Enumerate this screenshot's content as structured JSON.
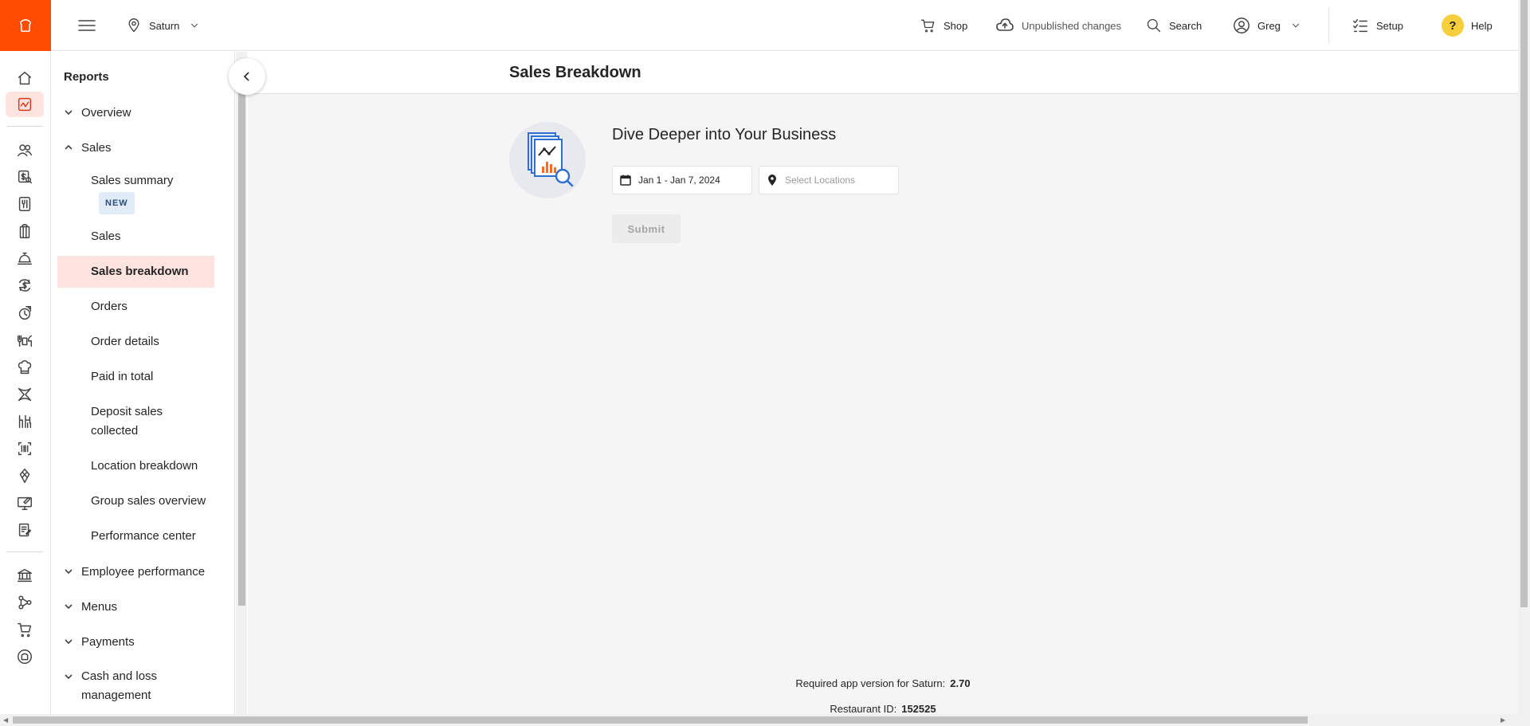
{
  "topbar": {
    "location": "Saturn",
    "shop": "Shop",
    "unpublished": "Unpublished changes",
    "search": "Search",
    "user": "Greg",
    "setup": "Setup",
    "help": "Help",
    "help_glyph": "?"
  },
  "rail": {
    "icons": [
      "home-icon",
      "reports-icon",
      "guests-icon",
      "payroll-icon",
      "menu-icon",
      "retail-icon",
      "service-icon",
      "money-icon",
      "marketing-icon",
      "dining-icon",
      "kitchen-icon",
      "integrations-icon",
      "floor-icon",
      "barcode-icon",
      "loyalty-icon",
      "kiosk-icon",
      "forms-icon",
      "bank-icon",
      "network-icon",
      "cart-icon",
      "brand-icon"
    ]
  },
  "sidebar": {
    "title": "Reports",
    "sections": {
      "overview": "Overview",
      "sales": "Sales",
      "employee_performance": "Employee performance",
      "menus": "Menus",
      "payments": "Payments",
      "cash_loss_1": "Cash and loss",
      "cash_loss_2": "management"
    },
    "items": {
      "sales_summary": "Sales summary",
      "new_badge": "NEW",
      "sales": "Sales",
      "sales_breakdown": "Sales breakdown",
      "orders": "Orders",
      "order_details": "Order details",
      "paid_in_total": "Paid in total",
      "deposit_1": "Deposit sales",
      "deposit_2": "collected",
      "location_breakdown": "Location breakdown",
      "group_sales": "Group sales overview",
      "performance_center": "Performance center"
    }
  },
  "main": {
    "title": "Sales Breakdown",
    "heading": "Dive Deeper into Your Business",
    "date_range": "Jan 1 - Jan 7, 2024",
    "location_placeholder": "Select Locations",
    "submit": "Submit",
    "app_version_label": "Required app version for Saturn:",
    "app_version": "2.70",
    "restaurant_id_label": "Restaurant ID:",
    "restaurant_id": "152525"
  },
  "colors": {
    "brand": "#ff4c00",
    "active_bg": "#fde4e1",
    "help_badge": "#f7cf3c"
  }
}
